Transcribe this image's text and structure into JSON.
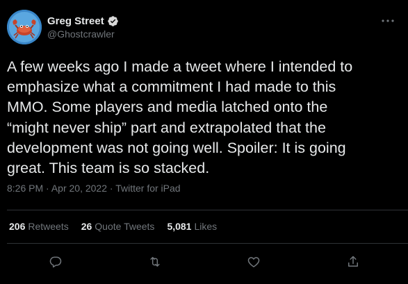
{
  "author": {
    "display_name": "Greg Street",
    "handle": "@Ghostcrawler",
    "avatar_icon": "crab-avatar",
    "verified_icon": "verified-badge-icon"
  },
  "tweet": {
    "text": "A few weeks ago I made a tweet where I intended to\nemphasize what a commitment I had made to this\nMMO. Some players and media latched onto the\n“might never ship” part and extrapolated that the\ndevelopment was not going well. Spoiler: It is going\ngreat. This team is so stacked.",
    "time": "8:26 PM",
    "separator": "·",
    "date": "Apr 20, 2022",
    "source": "Twitter for iPad"
  },
  "stats": {
    "retweets": {
      "count": "206",
      "label": "Retweets"
    },
    "quote_tweets": {
      "count": "26",
      "label": "Quote Tweets"
    },
    "likes": {
      "count": "5,081",
      "label": "Likes"
    }
  },
  "actions": [
    "reply-icon",
    "retweet-icon",
    "like-icon",
    "share-icon"
  ],
  "colors": {
    "background": "#000000",
    "text": "#e7e9ea",
    "secondary": "#71767b",
    "divider": "#2f3336",
    "accent": "#1d9bf0"
  }
}
